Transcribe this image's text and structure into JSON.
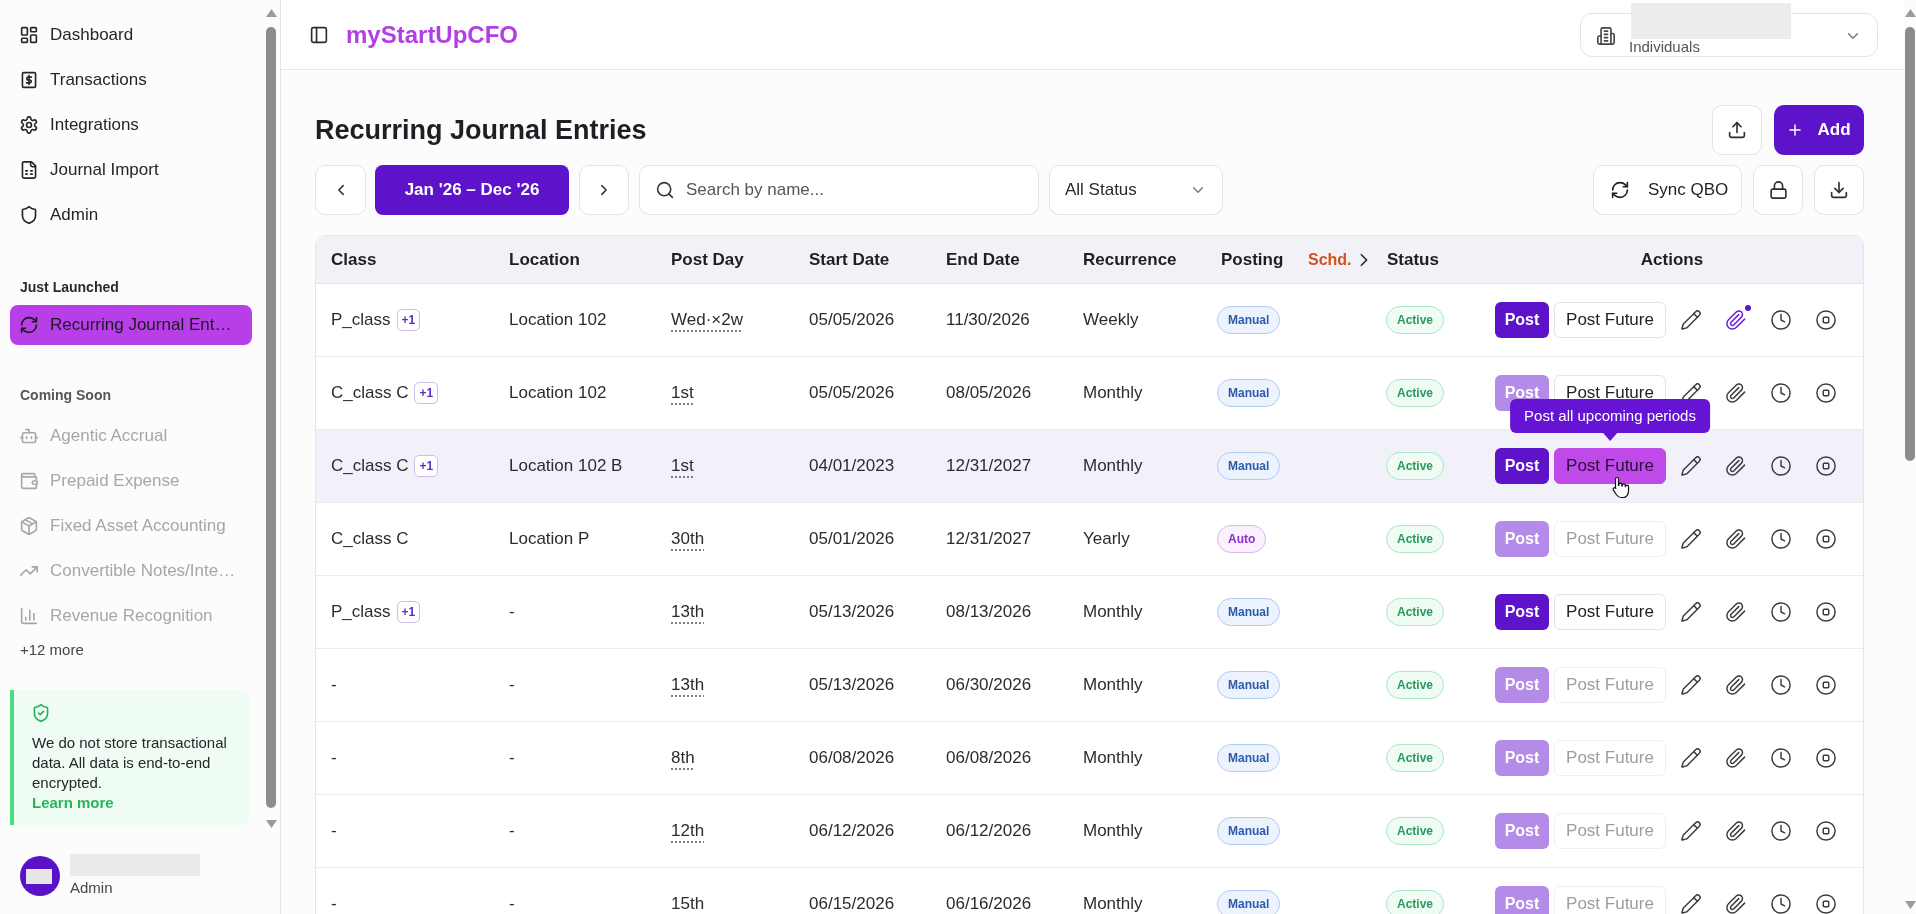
{
  "sidebar": {
    "nav_items": [
      {
        "label": "Dashboard",
        "selected": false
      },
      {
        "label": "Transactions",
        "selected": false
      },
      {
        "label": "Integrations",
        "selected": false
      },
      {
        "label": "Journal Import",
        "selected": false
      },
      {
        "label": "Admin",
        "selected": false
      }
    ],
    "sections": [
      {
        "title": "Just Launched",
        "items": [
          {
            "label": "Recurring Journal Ent…",
            "selected": true,
            "disabled": false
          }
        ]
      },
      {
        "title": "Coming Soon",
        "items": [
          {
            "label": "Agentic Accrual",
            "selected": false,
            "disabled": true
          },
          {
            "label": "Prepaid Expense",
            "selected": false,
            "disabled": true
          },
          {
            "label": "Fixed Asset Accounting",
            "selected": false,
            "disabled": true
          },
          {
            "label": "Convertible Notes/Inte…",
            "selected": false,
            "disabled": true
          },
          {
            "label": "Revenue Recognition",
            "selected": false,
            "disabled": true
          }
        ],
        "more": "+12 more"
      }
    ],
    "notice": {
      "text": "We do not store transactional data. All data is end-to-end encrypted.",
      "link": "Learn more"
    },
    "user": {
      "role": "Admin"
    }
  },
  "header": {
    "brand": "myStartUpCFO",
    "org_select": {
      "subtitle": "Individuals"
    }
  },
  "page": {
    "title": "Recurring Journal Entries",
    "add_button": "Add"
  },
  "toolbar": {
    "date_range": "Jan '26 – Dec '26",
    "search": {
      "placeholder": "Search by name..."
    },
    "status_filter": "All Status",
    "sync_button": "Sync QBO"
  },
  "table": {
    "columns": [
      {
        "label": "Class",
        "kind": "text"
      },
      {
        "label": "Location",
        "kind": "text"
      },
      {
        "label": "Post Day",
        "kind": "text"
      },
      {
        "label": "Start Date",
        "kind": "text"
      },
      {
        "label": "End Date",
        "kind": "text"
      },
      {
        "label": "Recurrence",
        "kind": "text"
      },
      {
        "label": "Posting",
        "kind": "text"
      },
      {
        "label": "Schd.",
        "kind": "toggle"
      },
      {
        "label": "Status",
        "kind": "text"
      },
      {
        "label": "Actions",
        "kind": "actions"
      }
    ],
    "rows": [
      {
        "class": "P_class",
        "class_more": "+1",
        "location": "Location 102",
        "post_day": "Wed·×2w",
        "start_date": "05/05/2026",
        "end_date": "11/30/2026",
        "recurrence": "Weekly",
        "posting": {
          "text": "Manual",
          "kind": "manual"
        },
        "status": {
          "text": "Active",
          "kind": "active"
        },
        "highlighted": false,
        "post": {
          "label": "Post",
          "disabled": false
        },
        "post_future": {
          "label": "Post Future",
          "disabled": false,
          "hovered": false
        },
        "has_attachments": true
      },
      {
        "class": "C_class C",
        "class_more": "+1",
        "location": "Location 102",
        "post_day": "1st",
        "start_date": "05/05/2026",
        "end_date": "08/05/2026",
        "recurrence": "Monthly",
        "posting": {
          "text": "Manual",
          "kind": "manual"
        },
        "status": {
          "text": "Active",
          "kind": "active"
        },
        "highlighted": false,
        "post": {
          "label": "Post",
          "disabled": true
        },
        "post_future": {
          "label": "Post Future",
          "disabled": false,
          "hovered": false
        },
        "has_attachments": false
      },
      {
        "class": "C_class C",
        "class_more": "+1",
        "location": "Location 102 B",
        "post_day": "1st",
        "start_date": "04/01/2023",
        "end_date": "12/31/2027",
        "recurrence": "Monthly",
        "posting": {
          "text": "Manual",
          "kind": "manual"
        },
        "status": {
          "text": "Active",
          "kind": "active"
        },
        "highlighted": true,
        "post": {
          "label": "Post",
          "disabled": false
        },
        "post_future": {
          "label": "Post Future",
          "disabled": false,
          "hovered": true,
          "tooltip": "Post all upcoming periods"
        },
        "has_attachments": false
      },
      {
        "class": "C_class C",
        "location": "Location P",
        "post_day": "30th",
        "start_date": "05/01/2026",
        "end_date": "12/31/2027",
        "recurrence": "Yearly",
        "posting": {
          "text": "Auto",
          "kind": "auto"
        },
        "status": {
          "text": "Active",
          "kind": "active"
        },
        "highlighted": false,
        "post": {
          "label": "Post",
          "disabled": true
        },
        "post_future": {
          "label": "Post Future",
          "disabled": true,
          "hovered": false
        },
        "has_attachments": false
      },
      {
        "class": "P_class",
        "class_more": "+1",
        "location": "-",
        "post_day": "13th",
        "start_date": "05/13/2026",
        "end_date": "08/13/2026",
        "recurrence": "Monthly",
        "posting": {
          "text": "Manual",
          "kind": "manual"
        },
        "status": {
          "text": "Active",
          "kind": "active"
        },
        "highlighted": false,
        "post": {
          "label": "Post",
          "disabled": false
        },
        "post_future": {
          "label": "Post Future",
          "disabled": false,
          "hovered": false
        },
        "has_attachments": false
      },
      {
        "class": "-",
        "location": "-",
        "post_day": "13th",
        "start_date": "05/13/2026",
        "end_date": "06/30/2026",
        "recurrence": "Monthly",
        "posting": {
          "text": "Manual",
          "kind": "manual"
        },
        "status": {
          "text": "Active",
          "kind": "active"
        },
        "highlighted": false,
        "post": {
          "label": "Post",
          "disabled": true
        },
        "post_future": {
          "label": "Post Future",
          "disabled": true,
          "hovered": false
        },
        "has_attachments": false
      },
      {
        "class": "-",
        "location": "-",
        "post_day": "8th",
        "start_date": "06/08/2026",
        "end_date": "06/08/2026",
        "recurrence": "Monthly",
        "posting": {
          "text": "Manual",
          "kind": "manual"
        },
        "status": {
          "text": "Active",
          "kind": "active"
        },
        "highlighted": false,
        "post": {
          "label": "Post",
          "disabled": true
        },
        "post_future": {
          "label": "Post Future",
          "disabled": true,
          "hovered": false
        },
        "has_attachments": false
      },
      {
        "class": "-",
        "location": "-",
        "post_day": "12th",
        "start_date": "06/12/2026",
        "end_date": "06/12/2026",
        "recurrence": "Monthly",
        "posting": {
          "text": "Manual",
          "kind": "manual"
        },
        "status": {
          "text": "Active",
          "kind": "active"
        },
        "highlighted": false,
        "post": {
          "label": "Post",
          "disabled": true
        },
        "post_future": {
          "label": "Post Future",
          "disabled": true,
          "hovered": false
        },
        "has_attachments": false
      },
      {
        "class": "-",
        "location": "-",
        "post_day": "15th",
        "start_date": "06/15/2026",
        "end_date": "06/16/2026",
        "recurrence": "Monthly",
        "posting": {
          "text": "Manual",
          "kind": "manual"
        },
        "status": {
          "text": "Active",
          "kind": "active"
        },
        "highlighted": false,
        "post": {
          "label": "Post",
          "disabled": true
        },
        "post_future": {
          "label": "Post Future",
          "disabled": true,
          "hovered": false
        },
        "has_attachments": false
      }
    ]
  }
}
